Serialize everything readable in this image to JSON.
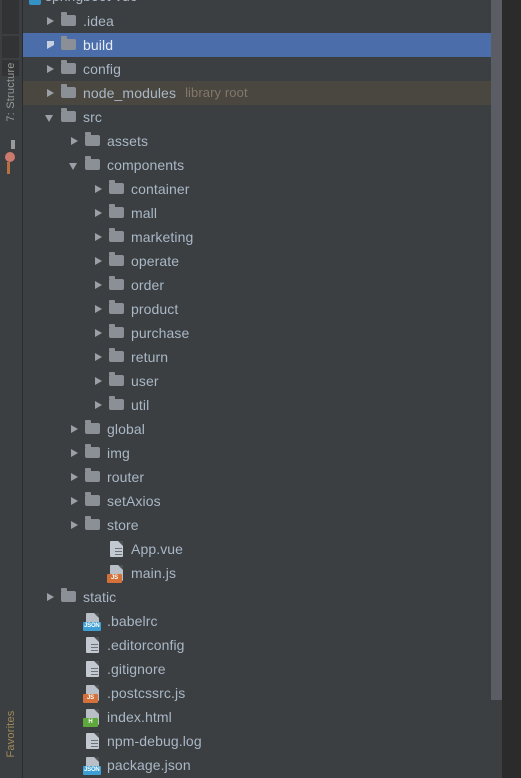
{
  "window": {
    "theme_bg": "#3c3f41",
    "accent_selection": "#4b6eab",
    "library_root_bg": "#4a4740",
    "text_color": "#a9b7c6"
  },
  "tool_stripe": {
    "tabs": [
      {
        "label": "7: Structure",
        "name": "structure-tool-tab"
      },
      {
        "label": "Favorites",
        "name": "favorites-tool-tab"
      }
    ]
  },
  "project_root": {
    "label": "springboot-vue"
  },
  "tree": {
    "rows": [
      {
        "label": ".idea",
        "type": "folder",
        "indent": 1,
        "twisty": "collapsed",
        "state": "normal"
      },
      {
        "label": "build",
        "type": "folder",
        "indent": 1,
        "twisty": "collapsed",
        "state": "selected"
      },
      {
        "label": "config",
        "type": "folder",
        "indent": 1,
        "twisty": "collapsed",
        "state": "normal"
      },
      {
        "label": "node_modules",
        "type": "folder",
        "indent": 1,
        "twisty": "collapsed",
        "state": "libroot",
        "sublabel": "library root"
      },
      {
        "label": "src",
        "type": "folder",
        "indent": 1,
        "twisty": "expanded",
        "state": "normal"
      },
      {
        "label": "assets",
        "type": "folder",
        "indent": 2,
        "twisty": "collapsed",
        "state": "normal"
      },
      {
        "label": "components",
        "type": "folder",
        "indent": 2,
        "twisty": "expanded",
        "state": "normal"
      },
      {
        "label": "container",
        "type": "folder",
        "indent": 3,
        "twisty": "collapsed",
        "state": "normal"
      },
      {
        "label": "mall",
        "type": "folder",
        "indent": 3,
        "twisty": "collapsed",
        "state": "normal"
      },
      {
        "label": "marketing",
        "type": "folder",
        "indent": 3,
        "twisty": "collapsed",
        "state": "normal"
      },
      {
        "label": "operate",
        "type": "folder",
        "indent": 3,
        "twisty": "collapsed",
        "state": "normal"
      },
      {
        "label": "order",
        "type": "folder",
        "indent": 3,
        "twisty": "collapsed",
        "state": "normal"
      },
      {
        "label": "product",
        "type": "folder",
        "indent": 3,
        "twisty": "collapsed",
        "state": "normal"
      },
      {
        "label": "purchase",
        "type": "folder",
        "indent": 3,
        "twisty": "collapsed",
        "state": "normal"
      },
      {
        "label": "return",
        "type": "folder",
        "indent": 3,
        "twisty": "collapsed",
        "state": "normal"
      },
      {
        "label": "user",
        "type": "folder",
        "indent": 3,
        "twisty": "collapsed",
        "state": "normal"
      },
      {
        "label": "util",
        "type": "folder",
        "indent": 3,
        "twisty": "collapsed",
        "state": "normal"
      },
      {
        "label": "global",
        "type": "folder",
        "indent": 2,
        "twisty": "collapsed",
        "state": "normal"
      },
      {
        "label": "img",
        "type": "folder",
        "indent": 2,
        "twisty": "collapsed",
        "state": "normal"
      },
      {
        "label": "router",
        "type": "folder",
        "indent": 2,
        "twisty": "collapsed",
        "state": "normal"
      },
      {
        "label": "setAxios",
        "type": "folder",
        "indent": 2,
        "twisty": "collapsed",
        "state": "normal"
      },
      {
        "label": "store",
        "type": "folder",
        "indent": 2,
        "twisty": "collapsed",
        "state": "normal"
      },
      {
        "label": "App.vue",
        "type": "file",
        "indent": 3,
        "twisty": "none",
        "state": "normal",
        "icon": "file-lined"
      },
      {
        "label": "main.js",
        "type": "file",
        "indent": 3,
        "twisty": "none",
        "state": "normal",
        "icon": "file-js",
        "badge": "JS"
      },
      {
        "label": "static",
        "type": "folder",
        "indent": 1,
        "twisty": "collapsed",
        "state": "normal"
      },
      {
        "label": ".babelrc",
        "type": "file",
        "indent": 2,
        "twisty": "none",
        "state": "normal",
        "icon": "file-json",
        "badge": "JSON"
      },
      {
        "label": ".editorconfig",
        "type": "file",
        "indent": 2,
        "twisty": "none",
        "state": "normal",
        "icon": "file-lined"
      },
      {
        "label": ".gitignore",
        "type": "file",
        "indent": 2,
        "twisty": "none",
        "state": "normal",
        "icon": "file-lined"
      },
      {
        "label": ".postcssrc.js",
        "type": "file",
        "indent": 2,
        "twisty": "none",
        "state": "normal",
        "icon": "file-js",
        "badge": "JS"
      },
      {
        "label": "index.html",
        "type": "file",
        "indent": 2,
        "twisty": "none",
        "state": "normal",
        "icon": "file-html",
        "badge": "H"
      },
      {
        "label": "npm-debug.log",
        "type": "file",
        "indent": 2,
        "twisty": "none",
        "state": "normal",
        "icon": "file-lined"
      },
      {
        "label": "package.json",
        "type": "file",
        "indent": 2,
        "twisty": "none",
        "state": "normal",
        "icon": "file-json",
        "badge": "JSON"
      }
    ]
  },
  "scrollbar": {
    "name": "vertical-scrollbar"
  }
}
